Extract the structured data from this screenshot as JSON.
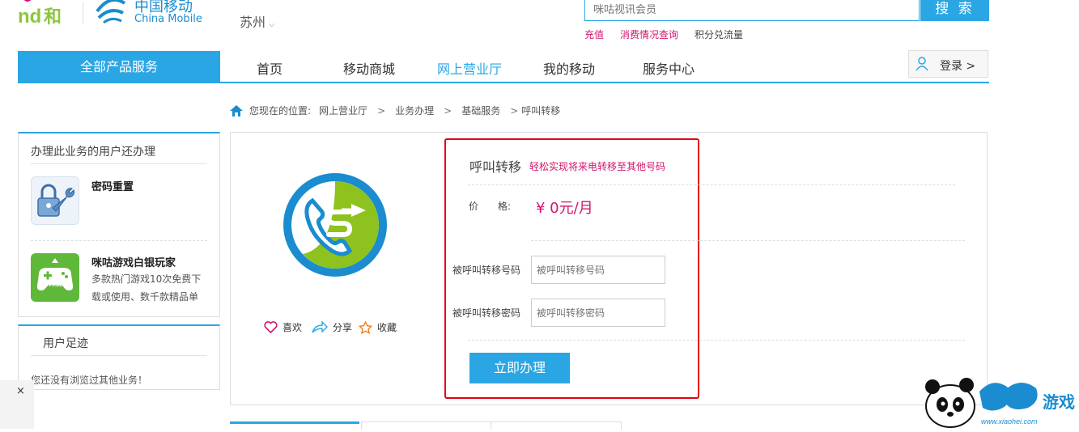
{
  "header": {
    "logo_and": "and和",
    "logo_cn": "中国移动",
    "logo_en": "China Mobile",
    "city": "苏州",
    "search_placeholder": "咪咕视讯会员",
    "search_button": "搜 索",
    "quick_links": [
      "充值",
      "消费情况查询",
      "积分兑流量"
    ]
  },
  "nav": {
    "all_products": "全部产品服务",
    "items": [
      "首页",
      "移动商城",
      "网上营业厅",
      "我的移动",
      "服务中心"
    ],
    "active": "网上营业厅",
    "login": "登录 >"
  },
  "breadcrumb": {
    "prefix": "您现在的位置:",
    "items": [
      "网上营业厅",
      "业务办理",
      "基础服务",
      "呼叫转移"
    ],
    "separator": ">"
  },
  "sidebar": {
    "also_title": "办理此业务的用户还办理",
    "products": [
      {
        "name": "密码重置",
        "desc": "",
        "icon": "lock-wrench-icon"
      },
      {
        "name": "咪咕游戏白银玩家",
        "desc": "多款热门游戏10次免费下载或使用、数千款精品单",
        "icon": "migu-gamepad-icon"
      }
    ],
    "footprint_title": "用户足迹",
    "footprint_note": "您还没有浏览过其他业务！",
    "close": "×"
  },
  "service": {
    "name": "呼叫转移",
    "tagline": "轻松实现将来电转移至其他号码",
    "price_label": "价　　格:",
    "price": "¥ 0元/月",
    "fields": [
      {
        "label": "被呼叫转移号码",
        "placeholder": "被呼叫转移号码"
      },
      {
        "label": "被呼叫转移密码",
        "placeholder": "被呼叫转移密码"
      }
    ],
    "submit": "立即办理",
    "actions": [
      "喜欢",
      "分享",
      "收藏"
    ]
  },
  "watermark": {
    "text": "小黑游戏",
    "url": "www.xiaohei.com"
  },
  "colors": {
    "accent": "#2aa6e4",
    "price": "#d0156b",
    "highlight_frame": "#e60012"
  }
}
